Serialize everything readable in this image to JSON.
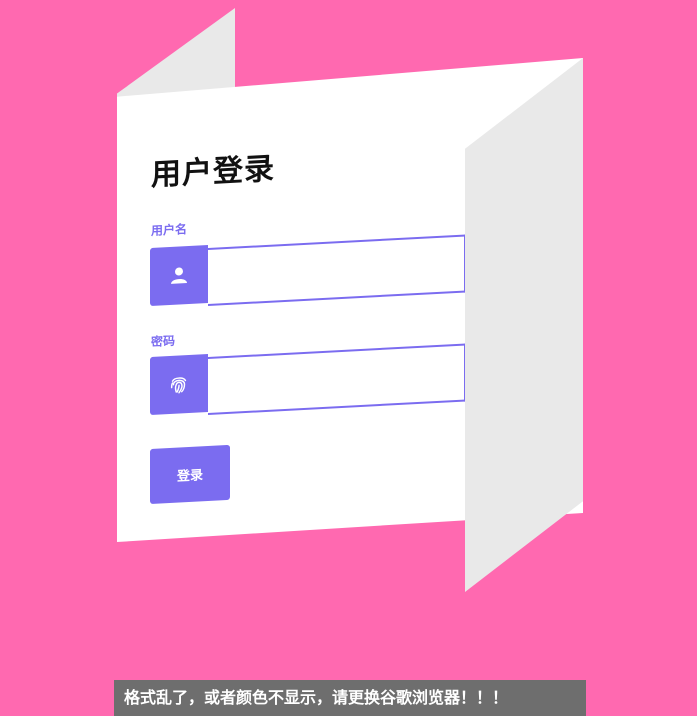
{
  "login": {
    "title": "用户登录",
    "username_label": "用户名",
    "username_value": "",
    "username_icon": "user-icon",
    "password_label": "密码",
    "password_value": "",
    "password_icon": "fingerprint-icon",
    "submit_label": "登录"
  },
  "banner": {
    "message": "格式乱了，或者颜色不显示，请更换谷歌浏览器！！！"
  },
  "colors": {
    "background": "#ff69b0",
    "accent": "#7b6cf0",
    "card": "#ffffff",
    "fold": "#e9e9e9",
    "banner": "#6e6e6e"
  }
}
